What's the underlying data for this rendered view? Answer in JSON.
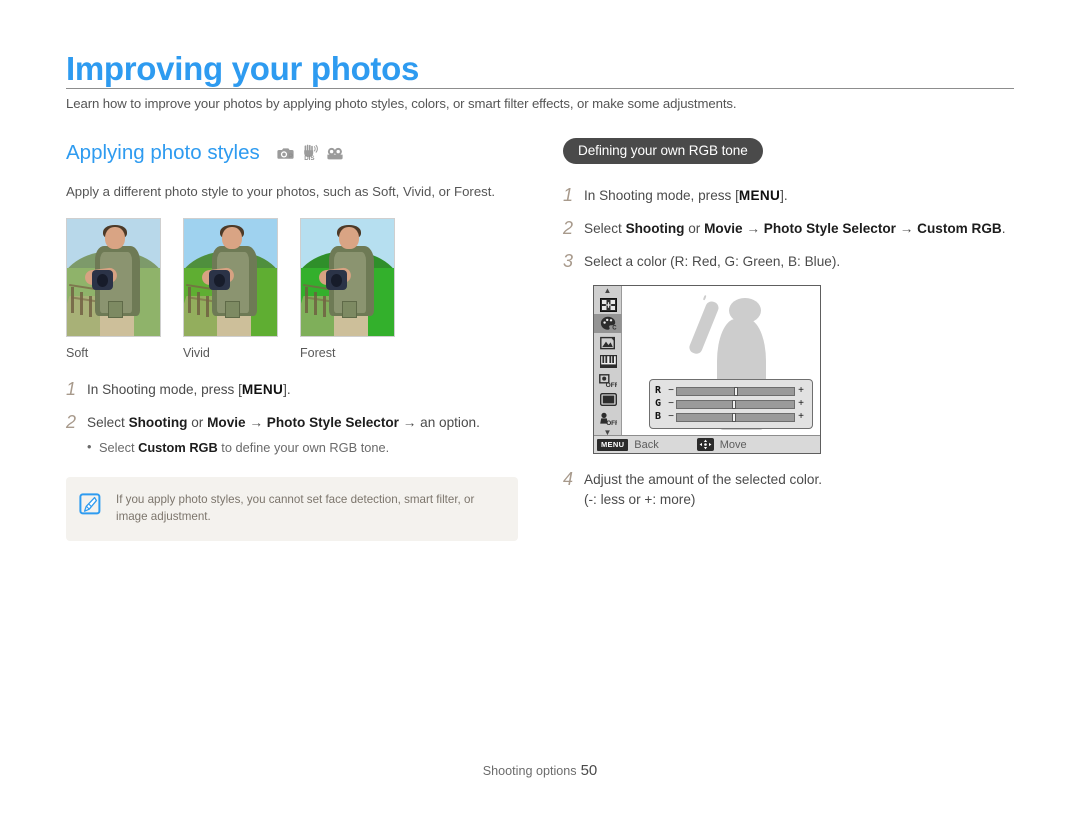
{
  "header": {
    "chapter_title": "Improving your photos",
    "intro": "Learn how to improve your photos by applying photo styles, colors, or smart filter effects, or make some adjustments.",
    "accent_color": "#2e9bf0",
    "rule_color": "#8d8d8d"
  },
  "left": {
    "section_title": "Applying photo styles",
    "mode_icons": [
      "camera-p-icon",
      "hand-dis-icon",
      "movie-camera-icon"
    ],
    "intro_paragraph": "Apply a different photo style to your photos, such as Soft, Vivid, or Forest.",
    "samples": [
      {
        "label": "Soft",
        "sky": "#b8d8ea",
        "hill": "#7d9a6a",
        "field": "#8fb36a"
      },
      {
        "label": "Vivid",
        "sky": "#9fd2ef",
        "hill": "#4f8f3d",
        "field": "#5fae32"
      },
      {
        "label": "Forest",
        "sky": "#b6dff0",
        "hill": "#2f8f2a",
        "field": "#33b02c"
      }
    ],
    "steps": [
      {
        "num": "1",
        "prefix": "In Shooting mode, press [",
        "key": "MENU",
        "suffix": "]."
      },
      {
        "num": "2",
        "line_parts": [
          {
            "t": "Select ",
            "b": false
          },
          {
            "t": "Shooting",
            "b": true
          },
          {
            "t": " or ",
            "b": false
          },
          {
            "t": "Movie",
            "b": true
          },
          {
            "t": " → ",
            "b": false
          },
          {
            "t": "Photo Style Selector",
            "b": true
          },
          {
            "t": " → ",
            "b": false
          },
          {
            "t": "an option.",
            "b": false
          }
        ],
        "bullet_parts": [
          {
            "t": "Select ",
            "b": false
          },
          {
            "t": "Custom RGB",
            "b": true
          },
          {
            "t": " to define your own RGB tone.",
            "b": false
          }
        ]
      }
    ],
    "note": {
      "icon": "note-pen-icon",
      "text": "If you apply photo styles, you cannot set face detection, smart filter, or image adjustment."
    }
  },
  "right": {
    "pill_title": "Defining your own RGB tone",
    "steps": [
      {
        "num": "1",
        "prefix": "In Shooting mode, press [",
        "key": "MENU",
        "suffix": "]."
      },
      {
        "num": "2",
        "line_parts": [
          {
            "t": "Select ",
            "b": false
          },
          {
            "t": "Shooting",
            "b": true
          },
          {
            "t": " or ",
            "b": false
          },
          {
            "t": "Movie",
            "b": true
          },
          {
            "t": " → ",
            "b": false
          },
          {
            "t": "Photo Style Selector",
            "b": true
          },
          {
            "t": " → ",
            "b": false
          },
          {
            "t": "Custom RGB",
            "b": true
          },
          {
            "t": ".",
            "b": false
          }
        ]
      },
      {
        "num": "3",
        "line_parts": [
          {
            "t": "Select a color (R: Red, G: Green, B: Blue).",
            "b": false
          }
        ]
      },
      {
        "num": "4",
        "line_parts": [
          {
            "t": "Adjust the amount of the selected color.",
            "b": false
          }
        ],
        "second_line": "(-: less or +: more)"
      }
    ],
    "lcd": {
      "sidebar_icons": [
        "scroll-up-arrow-icon",
        "ev-grid-icon",
        "color-palette-icon",
        "image-adjust-icon",
        "piano-keys-icon",
        "face-detection-off-icon",
        "frame-guide-icon",
        "smart-filter-off-icon",
        "scroll-down-arrow-icon"
      ],
      "selected_icon": "color-palette-icon",
      "sliders": [
        {
          "label": "R",
          "minus": "−",
          "plus": "+",
          "value": 50
        },
        {
          "label": "G",
          "minus": "−",
          "plus": "+",
          "value": 49
        },
        {
          "label": "B",
          "minus": "−",
          "plus": "+",
          "value": 49
        }
      ],
      "bottom_bar": {
        "menu_chip": "MENU",
        "back_label": "Back",
        "nav_icon": "four-way-nav-icon",
        "move_label": "Move"
      }
    }
  },
  "footer": {
    "section_label": "Shooting options",
    "page_number": "50"
  }
}
